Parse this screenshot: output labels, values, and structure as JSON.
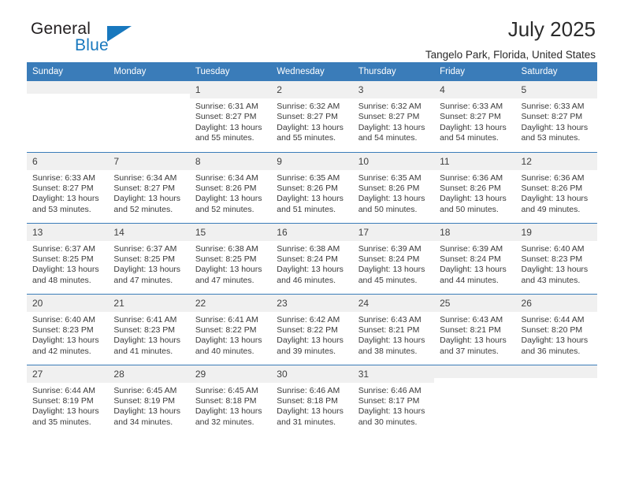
{
  "logo": {
    "word_one": "General",
    "word_two": "Blue",
    "triangle": "triangle-icon",
    "accent_color": "#1878be"
  },
  "header": {
    "title": "July 2025",
    "subtitle": "Tangelo Park, Florida, United States"
  },
  "theme": {
    "header_bar": "#3a7cb9",
    "daynum_band": "#f0f0f0",
    "text": "#333333"
  },
  "calendar": {
    "weekdays": [
      "Sunday",
      "Monday",
      "Tuesday",
      "Wednesday",
      "Thursday",
      "Friday",
      "Saturday"
    ],
    "weeks": [
      [
        {
          "day": "",
          "sunrise": "",
          "sunset": "",
          "daylight": ""
        },
        {
          "day": "",
          "sunrise": "",
          "sunset": "",
          "daylight": ""
        },
        {
          "day": "1",
          "sunrise": "Sunrise: 6:31 AM",
          "sunset": "Sunset: 8:27 PM",
          "daylight": "Daylight: 13 hours and 55 minutes."
        },
        {
          "day": "2",
          "sunrise": "Sunrise: 6:32 AM",
          "sunset": "Sunset: 8:27 PM",
          "daylight": "Daylight: 13 hours and 55 minutes."
        },
        {
          "day": "3",
          "sunrise": "Sunrise: 6:32 AM",
          "sunset": "Sunset: 8:27 PM",
          "daylight": "Daylight: 13 hours and 54 minutes."
        },
        {
          "day": "4",
          "sunrise": "Sunrise: 6:33 AM",
          "sunset": "Sunset: 8:27 PM",
          "daylight": "Daylight: 13 hours and 54 minutes."
        },
        {
          "day": "5",
          "sunrise": "Sunrise: 6:33 AM",
          "sunset": "Sunset: 8:27 PM",
          "daylight": "Daylight: 13 hours and 53 minutes."
        }
      ],
      [
        {
          "day": "6",
          "sunrise": "Sunrise: 6:33 AM",
          "sunset": "Sunset: 8:27 PM",
          "daylight": "Daylight: 13 hours and 53 minutes."
        },
        {
          "day": "7",
          "sunrise": "Sunrise: 6:34 AM",
          "sunset": "Sunset: 8:27 PM",
          "daylight": "Daylight: 13 hours and 52 minutes."
        },
        {
          "day": "8",
          "sunrise": "Sunrise: 6:34 AM",
          "sunset": "Sunset: 8:26 PM",
          "daylight": "Daylight: 13 hours and 52 minutes."
        },
        {
          "day": "9",
          "sunrise": "Sunrise: 6:35 AM",
          "sunset": "Sunset: 8:26 PM",
          "daylight": "Daylight: 13 hours and 51 minutes."
        },
        {
          "day": "10",
          "sunrise": "Sunrise: 6:35 AM",
          "sunset": "Sunset: 8:26 PM",
          "daylight": "Daylight: 13 hours and 50 minutes."
        },
        {
          "day": "11",
          "sunrise": "Sunrise: 6:36 AM",
          "sunset": "Sunset: 8:26 PM",
          "daylight": "Daylight: 13 hours and 50 minutes."
        },
        {
          "day": "12",
          "sunrise": "Sunrise: 6:36 AM",
          "sunset": "Sunset: 8:26 PM",
          "daylight": "Daylight: 13 hours and 49 minutes."
        }
      ],
      [
        {
          "day": "13",
          "sunrise": "Sunrise: 6:37 AM",
          "sunset": "Sunset: 8:25 PM",
          "daylight": "Daylight: 13 hours and 48 minutes."
        },
        {
          "day": "14",
          "sunrise": "Sunrise: 6:37 AM",
          "sunset": "Sunset: 8:25 PM",
          "daylight": "Daylight: 13 hours and 47 minutes."
        },
        {
          "day": "15",
          "sunrise": "Sunrise: 6:38 AM",
          "sunset": "Sunset: 8:25 PM",
          "daylight": "Daylight: 13 hours and 47 minutes."
        },
        {
          "day": "16",
          "sunrise": "Sunrise: 6:38 AM",
          "sunset": "Sunset: 8:24 PM",
          "daylight": "Daylight: 13 hours and 46 minutes."
        },
        {
          "day": "17",
          "sunrise": "Sunrise: 6:39 AM",
          "sunset": "Sunset: 8:24 PM",
          "daylight": "Daylight: 13 hours and 45 minutes."
        },
        {
          "day": "18",
          "sunrise": "Sunrise: 6:39 AM",
          "sunset": "Sunset: 8:24 PM",
          "daylight": "Daylight: 13 hours and 44 minutes."
        },
        {
          "day": "19",
          "sunrise": "Sunrise: 6:40 AM",
          "sunset": "Sunset: 8:23 PM",
          "daylight": "Daylight: 13 hours and 43 minutes."
        }
      ],
      [
        {
          "day": "20",
          "sunrise": "Sunrise: 6:40 AM",
          "sunset": "Sunset: 8:23 PM",
          "daylight": "Daylight: 13 hours and 42 minutes."
        },
        {
          "day": "21",
          "sunrise": "Sunrise: 6:41 AM",
          "sunset": "Sunset: 8:23 PM",
          "daylight": "Daylight: 13 hours and 41 minutes."
        },
        {
          "day": "22",
          "sunrise": "Sunrise: 6:41 AM",
          "sunset": "Sunset: 8:22 PM",
          "daylight": "Daylight: 13 hours and 40 minutes."
        },
        {
          "day": "23",
          "sunrise": "Sunrise: 6:42 AM",
          "sunset": "Sunset: 8:22 PM",
          "daylight": "Daylight: 13 hours and 39 minutes."
        },
        {
          "day": "24",
          "sunrise": "Sunrise: 6:43 AM",
          "sunset": "Sunset: 8:21 PM",
          "daylight": "Daylight: 13 hours and 38 minutes."
        },
        {
          "day": "25",
          "sunrise": "Sunrise: 6:43 AM",
          "sunset": "Sunset: 8:21 PM",
          "daylight": "Daylight: 13 hours and 37 minutes."
        },
        {
          "day": "26",
          "sunrise": "Sunrise: 6:44 AM",
          "sunset": "Sunset: 8:20 PM",
          "daylight": "Daylight: 13 hours and 36 minutes."
        }
      ],
      [
        {
          "day": "27",
          "sunrise": "Sunrise: 6:44 AM",
          "sunset": "Sunset: 8:19 PM",
          "daylight": "Daylight: 13 hours and 35 minutes."
        },
        {
          "day": "28",
          "sunrise": "Sunrise: 6:45 AM",
          "sunset": "Sunset: 8:19 PM",
          "daylight": "Daylight: 13 hours and 34 minutes."
        },
        {
          "day": "29",
          "sunrise": "Sunrise: 6:45 AM",
          "sunset": "Sunset: 8:18 PM",
          "daylight": "Daylight: 13 hours and 32 minutes."
        },
        {
          "day": "30",
          "sunrise": "Sunrise: 6:46 AM",
          "sunset": "Sunset: 8:18 PM",
          "daylight": "Daylight: 13 hours and 31 minutes."
        },
        {
          "day": "31",
          "sunrise": "Sunrise: 6:46 AM",
          "sunset": "Sunset: 8:17 PM",
          "daylight": "Daylight: 13 hours and 30 minutes."
        },
        {
          "day": "",
          "sunrise": "",
          "sunset": "",
          "daylight": ""
        },
        {
          "day": "",
          "sunrise": "",
          "sunset": "",
          "daylight": ""
        }
      ]
    ]
  }
}
